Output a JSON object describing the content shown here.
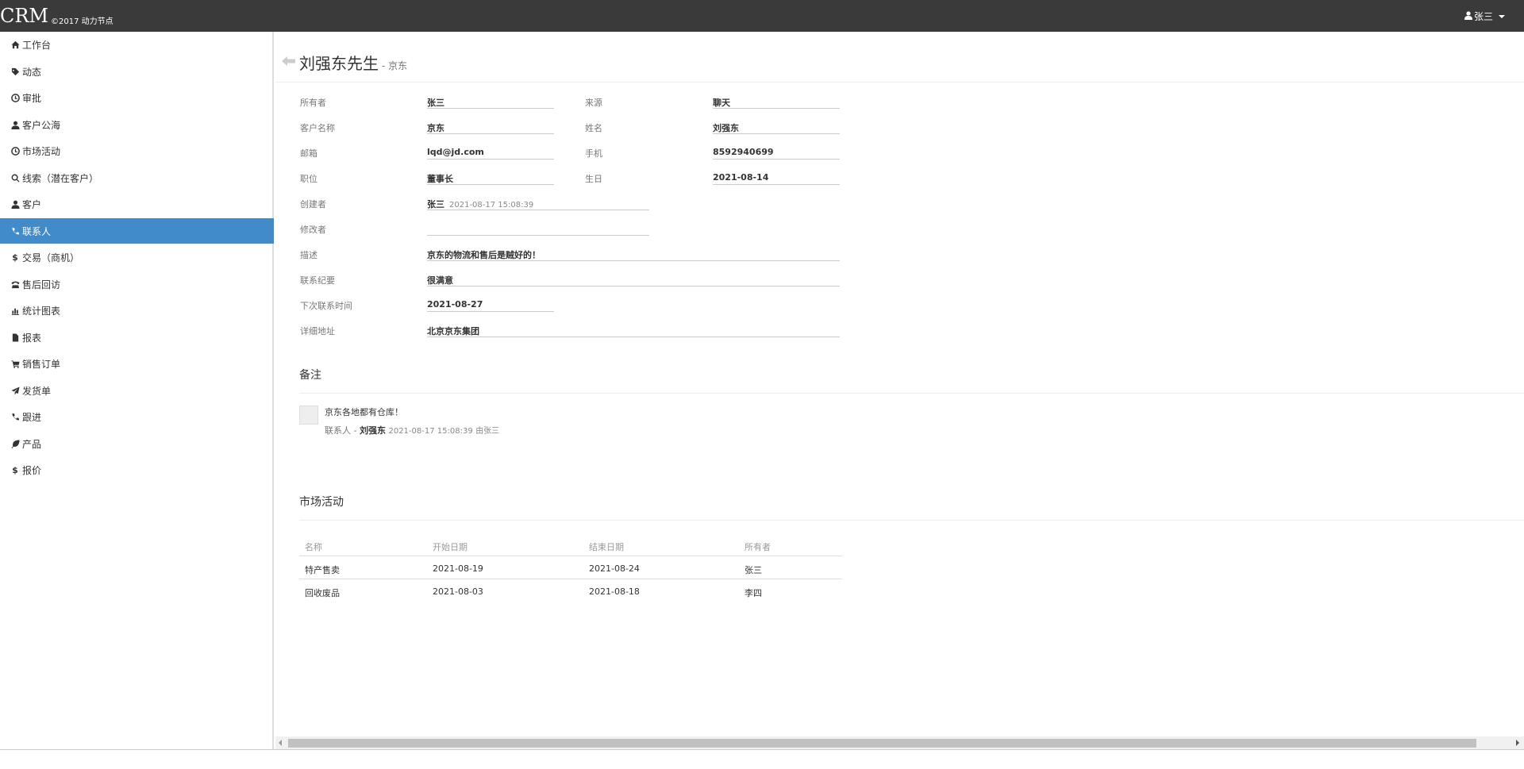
{
  "brand": {
    "title": "CRM",
    "subtitle": "©2017 动力节点"
  },
  "user": {
    "name": "张三"
  },
  "sidebar": {
    "items": [
      {
        "label": "工作台",
        "icon": "home-icon"
      },
      {
        "label": "动态",
        "icon": "tag-icon"
      },
      {
        "label": "审批",
        "icon": "clock-icon"
      },
      {
        "label": "客户公海",
        "icon": "user-icon"
      },
      {
        "label": "市场活动",
        "icon": "clock-icon"
      },
      {
        "label": "线索（潜在客户）",
        "icon": "search-icon"
      },
      {
        "label": "客户",
        "icon": "user-icon"
      },
      {
        "label": "联系人",
        "icon": "phone-icon",
        "active": true
      },
      {
        "label": "交易（商机）",
        "icon": "dollar-icon"
      },
      {
        "label": "售后回访",
        "icon": "phone-alt-icon"
      },
      {
        "label": "统计图表",
        "icon": "stats-icon"
      },
      {
        "label": "报表",
        "icon": "file-icon"
      },
      {
        "label": "销售订单",
        "icon": "cart-icon"
      },
      {
        "label": "发货单",
        "icon": "send-icon"
      },
      {
        "label": "跟进",
        "icon": "phone-icon"
      },
      {
        "label": "产品",
        "icon": "leaf-icon"
      },
      {
        "label": "报价",
        "icon": "dollar-icon"
      }
    ]
  },
  "header": {
    "title": "刘强东先生",
    "subtitle": "- 京东"
  },
  "fields": {
    "owner_label": "所有者",
    "owner": "张三",
    "source_label": "来源",
    "source": "聊天",
    "customer_label": "客户名称",
    "customer": "京东",
    "name_label": "姓名",
    "name": "刘强东",
    "email_label": "邮箱",
    "email": "lqd@jd.com",
    "phone_label": "手机",
    "phone": "8592940699",
    "job_label": "职位",
    "job": "董事长",
    "birthday_label": "生日",
    "birthday": "2021-08-14",
    "creator_label": "创建者",
    "creator": "张三",
    "create_time": "2021-08-17 15:08:39",
    "editor_label": "修改者",
    "description_label": "描述",
    "description": "京东的物流和售后是贼好的！",
    "summary_label": "联系纪要",
    "summary": "很满意",
    "next_contact_label": "下次联系时间",
    "next_contact": "2021-08-27",
    "address_label": "详细地址",
    "address": "北京京东集团"
  },
  "remarks": {
    "title": "备注",
    "items": [
      {
        "text": "京东各地都有仓库！",
        "type": "联系人 -",
        "person": "刘强东",
        "time": "2021-08-17 15:08:39",
        "by": "由张三"
      }
    ]
  },
  "activities": {
    "title": "市场活动",
    "columns": [
      "名称",
      "开始日期",
      "结束日期",
      "所有者"
    ],
    "rows": [
      [
        "特产售卖",
        "2021-08-19",
        "2021-08-24",
        "张三"
      ],
      [
        "回收废品",
        "2021-08-03",
        "2021-08-18",
        "李四"
      ]
    ]
  }
}
